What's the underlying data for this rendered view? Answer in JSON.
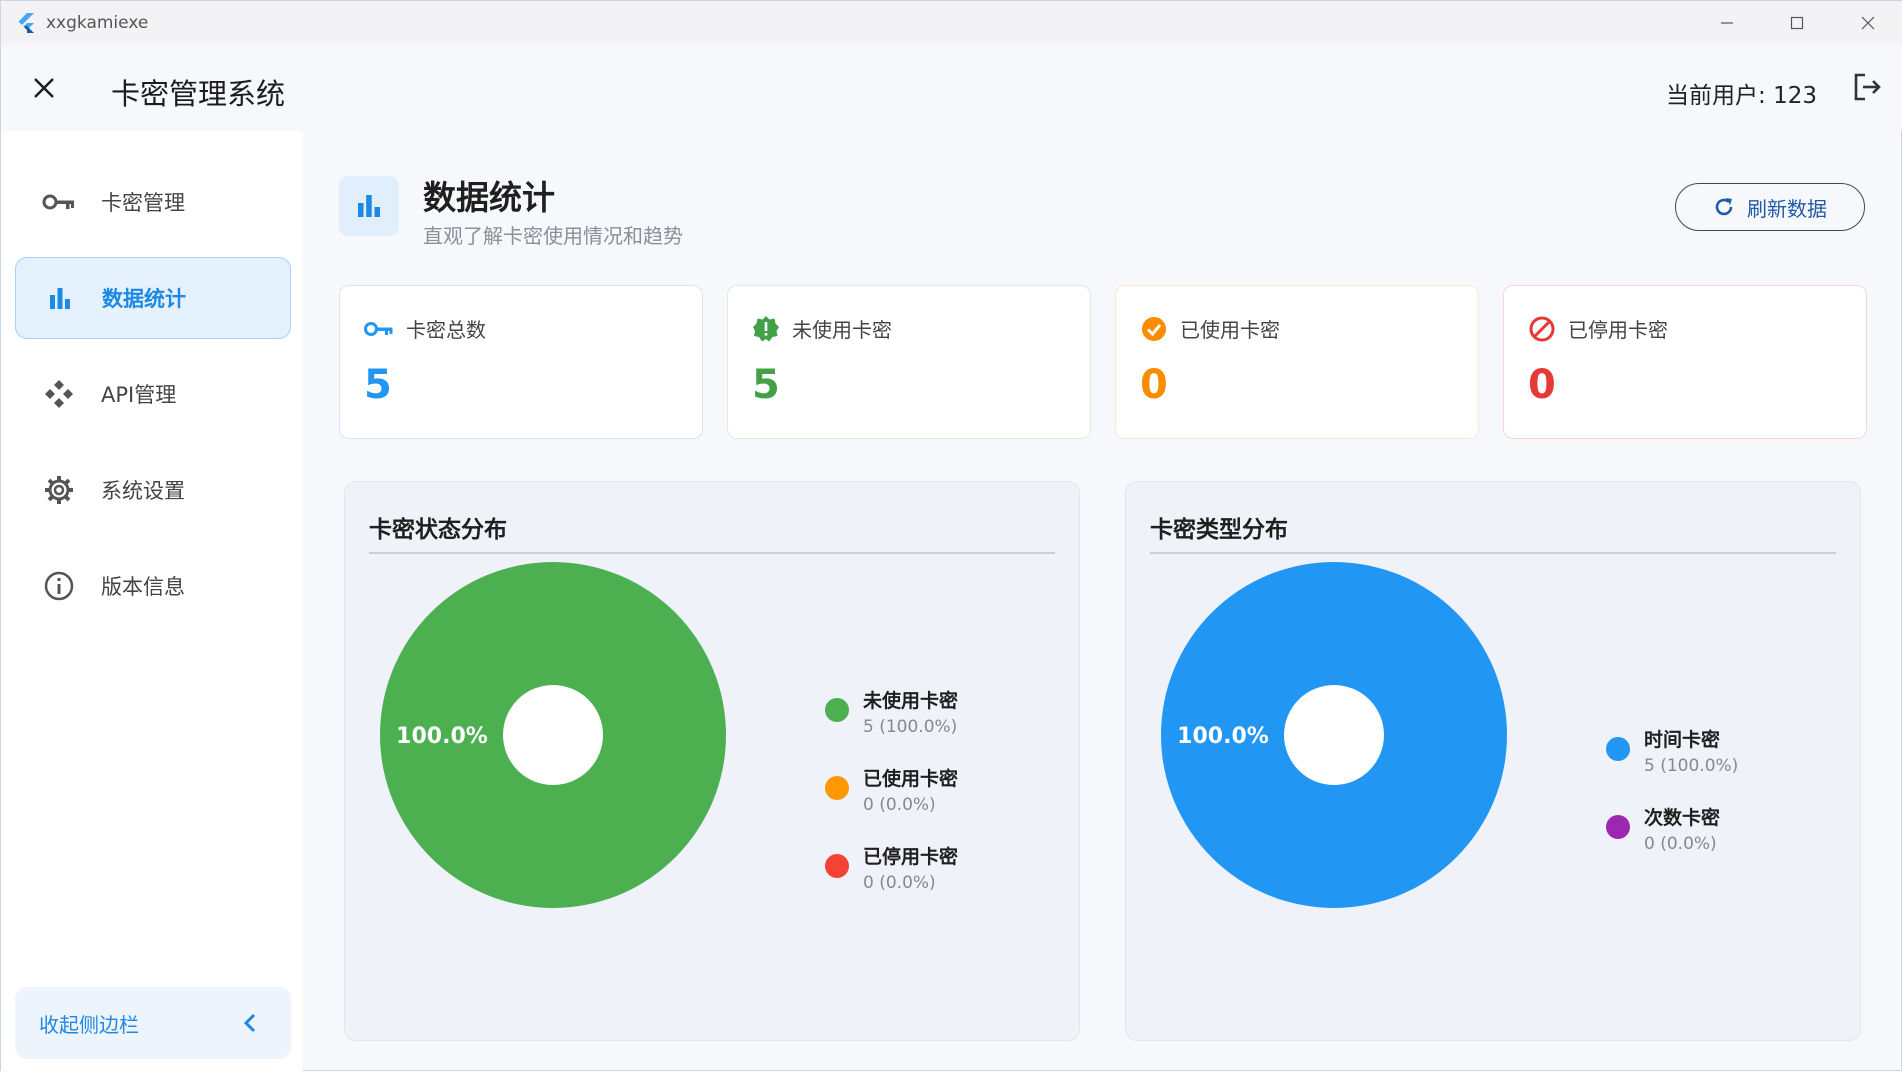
{
  "window": {
    "app_name": "xxgkamiexe"
  },
  "header": {
    "title": "卡密管理系统",
    "current_user": "当前用户: 123"
  },
  "sidebar": {
    "items": [
      {
        "label": "卡密管理",
        "icon": "key-icon",
        "active": false
      },
      {
        "label": "数据统计",
        "icon": "bar-chart-icon",
        "active": true
      },
      {
        "label": "API管理",
        "icon": "api-icon",
        "active": false
      },
      {
        "label": "系统设置",
        "icon": "gear-icon",
        "active": false
      },
      {
        "label": "版本信息",
        "icon": "info-icon",
        "active": false
      }
    ],
    "collapse_label": "收起侧边栏"
  },
  "page": {
    "title": "数据统计",
    "subtitle": "直观了解卡密使用情况和趋势",
    "refresh_label": "刷新数据"
  },
  "stats": [
    {
      "label": "卡密总数",
      "value": "5",
      "icon": "key-icon",
      "color": "#2196f3",
      "border": "#d4e6f8"
    },
    {
      "label": "未使用卡密",
      "value": "5",
      "icon": "new-badge-icon",
      "color": "#43a047",
      "border": "#dbeedb"
    },
    {
      "label": "已使用卡密",
      "value": "0",
      "icon": "check-circle-icon",
      "color": "#fb8c00",
      "border": "#fbe6cf"
    },
    {
      "label": "已停用卡密",
      "value": "0",
      "icon": "block-icon",
      "color": "#e53935",
      "border": "#f8d6d6"
    }
  ],
  "charts": [
    {
      "title": "卡密状态分布",
      "center_label": "100.0%",
      "legend": [
        {
          "name": "未使用卡密",
          "meta": "5 (100.0%)",
          "color": "#4caf50"
        },
        {
          "name": "已使用卡密",
          "meta": "0 (0.0%)",
          "color": "#ff9800"
        },
        {
          "name": "已停用卡密",
          "meta": "0 (0.0%)",
          "color": "#f44336"
        }
      ]
    },
    {
      "title": "卡密类型分布",
      "center_label": "100.0%",
      "legend": [
        {
          "name": "时间卡密",
          "meta": "5 (100.0%)",
          "color": "#2196f3"
        },
        {
          "name": "次数卡密",
          "meta": "0 (0.0%)",
          "color": "#9c27b0"
        }
      ]
    }
  ],
  "chart_data": [
    {
      "type": "pie",
      "title": "卡密状态分布",
      "categories": [
        "未使用卡密",
        "已使用卡密",
        "已停用卡密"
      ],
      "values": [
        5,
        0,
        0
      ],
      "colors": [
        "#4caf50",
        "#ff9800",
        "#f44336"
      ],
      "donut": true,
      "legend": "right"
    },
    {
      "type": "pie",
      "title": "卡密类型分布",
      "categories": [
        "时间卡密",
        "次数卡密"
      ],
      "values": [
        5,
        0
      ],
      "colors": [
        "#2196f3",
        "#9c27b0"
      ],
      "donut": true,
      "legend": "right"
    }
  ]
}
